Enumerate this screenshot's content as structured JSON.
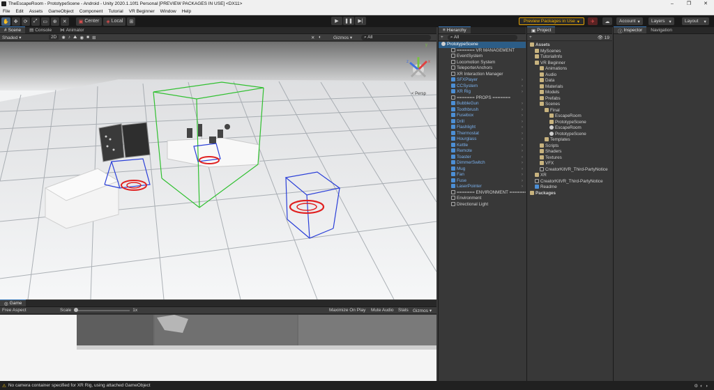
{
  "window": {
    "title": "TheEscapeRoom - PrototypeScene - Android - Unity 2020.1.10f1 Personal [PREVIEW PACKAGES IN USE] <DX11>",
    "controls": [
      "–",
      "❐",
      "✕"
    ]
  },
  "menu": [
    "File",
    "Edit",
    "Assets",
    "GameObject",
    "Component",
    "Tutorial",
    "VR Beginner",
    "Window",
    "Help"
  ],
  "toolbar": {
    "center_label": "Center",
    "local_label": "Local",
    "preview_label": "Preview Packages in Use",
    "account_label": "Account",
    "layers_label": "Layers",
    "layout_label": "Layout"
  },
  "scene": {
    "tabs": [
      "Scene",
      "Console",
      "Animator"
    ],
    "shading": "Shaded",
    "mode_2d": "2D",
    "gizmos_label": "Gizmos",
    "search_prefix": "All",
    "persp_label": "< Persp",
    "axis": {
      "x": "x",
      "y": "y",
      "z": "z"
    }
  },
  "game": {
    "tab": "Game",
    "aspect": "Free Aspect",
    "scale_label": "Scale",
    "scale_value": "1x",
    "maximize": "Maximize On Play",
    "mute": "Mute Audio",
    "stats": "Stats",
    "gizmos": "Gizmos"
  },
  "hierarchy": {
    "tab": "Hierarchy",
    "search_prefix": "All",
    "add_label": "+",
    "rows": [
      {
        "label": "PrototypeScene",
        "indent": 0,
        "kind": "unity",
        "sel": true
      },
      {
        "label": "======= VR MANAGEMENT",
        "indent": 2,
        "kind": "cube"
      },
      {
        "label": "EventSystem",
        "indent": 2,
        "kind": "cube"
      },
      {
        "label": "Locomotion System",
        "indent": 2,
        "kind": "cube"
      },
      {
        "label": "TeleporterAnchors",
        "indent": 2,
        "kind": "cube"
      },
      {
        "label": "XR Interaction Manager",
        "indent": 2,
        "kind": "cube"
      },
      {
        "label": "SFXPlayer",
        "indent": 2,
        "kind": "blue",
        "prefab": true
      },
      {
        "label": "CCSystem",
        "indent": 2,
        "kind": "blue",
        "prefab": true
      },
      {
        "label": "XR Rig",
        "indent": 2,
        "kind": "blue",
        "prefab": true
      },
      {
        "label": "======= PROPS =======",
        "indent": 2,
        "kind": "cube"
      },
      {
        "label": "BubbleGun",
        "indent": 2,
        "kind": "blue",
        "prefab": true
      },
      {
        "label": "Toothbrush",
        "indent": 2,
        "kind": "blue",
        "prefab": true
      },
      {
        "label": "Fusebox",
        "indent": 2,
        "kind": "blue",
        "prefab": true
      },
      {
        "label": "Drill",
        "indent": 2,
        "kind": "blue",
        "prefab": true
      },
      {
        "label": "Flashlight",
        "indent": 2,
        "kind": "blue",
        "prefab": true
      },
      {
        "label": "Thermostat",
        "indent": 2,
        "kind": "blue",
        "prefab": true
      },
      {
        "label": "Hourglass",
        "indent": 2,
        "kind": "blue",
        "prefab": true
      },
      {
        "label": "Kettle",
        "indent": 2,
        "kind": "blue",
        "prefab": true
      },
      {
        "label": "Remote",
        "indent": 2,
        "kind": "blue",
        "prefab": true
      },
      {
        "label": "Toaster",
        "indent": 2,
        "kind": "blue",
        "prefab": true
      },
      {
        "label": "DimmerSwitch",
        "indent": 2,
        "kind": "blue",
        "prefab": true
      },
      {
        "label": "Mug",
        "indent": 2,
        "kind": "blue",
        "prefab": true
      },
      {
        "label": "Fan",
        "indent": 2,
        "kind": "blue",
        "prefab": true
      },
      {
        "label": "Fuse",
        "indent": 2,
        "kind": "blue",
        "prefab": true
      },
      {
        "label": "LaserPointer",
        "indent": 2,
        "kind": "blue",
        "prefab": true
      },
      {
        "label": "======= ENVIRONMENT =======",
        "indent": 2,
        "kind": "cube"
      },
      {
        "label": "Environment",
        "indent": 2,
        "kind": "cube"
      },
      {
        "label": "Directional Light",
        "indent": 2,
        "kind": "cube"
      }
    ]
  },
  "project": {
    "tab": "Project",
    "add_label": "+",
    "badge": "19",
    "rows": [
      {
        "label": "Assets",
        "indent": 0,
        "kind": "folder",
        "bold": true
      },
      {
        "label": "MyScenes",
        "indent": 1,
        "kind": "folder"
      },
      {
        "label": "TutorialInfo",
        "indent": 1,
        "kind": "folder"
      },
      {
        "label": "VR Beginner",
        "indent": 1,
        "kind": "folder"
      },
      {
        "label": "Animations",
        "indent": 2,
        "kind": "folder"
      },
      {
        "label": "Audio",
        "indent": 2,
        "kind": "folder"
      },
      {
        "label": "Data",
        "indent": 2,
        "kind": "folder"
      },
      {
        "label": "Materials",
        "indent": 2,
        "kind": "folder"
      },
      {
        "label": "Models",
        "indent": 2,
        "kind": "folder"
      },
      {
        "label": "Prefabs",
        "indent": 2,
        "kind": "folder"
      },
      {
        "label": "Scenes",
        "indent": 2,
        "kind": "folder"
      },
      {
        "label": "Final",
        "indent": 3,
        "kind": "folder"
      },
      {
        "label": "EscapeRoom",
        "indent": 4,
        "kind": "folder"
      },
      {
        "label": "PrototypeScene",
        "indent": 4,
        "kind": "folder"
      },
      {
        "label": "EscapeRoom",
        "indent": 4,
        "kind": "unity"
      },
      {
        "label": "PrototypeScene",
        "indent": 4,
        "kind": "unity"
      },
      {
        "label": "Templates",
        "indent": 3,
        "kind": "folder"
      },
      {
        "label": "Scripts",
        "indent": 2,
        "kind": "folder"
      },
      {
        "label": "Shaders",
        "indent": 2,
        "kind": "folder"
      },
      {
        "label": "Textures",
        "indent": 2,
        "kind": "folder"
      },
      {
        "label": "VFX",
        "indent": 2,
        "kind": "folder"
      },
      {
        "label": "CreatorKitVR_Third-PartyNotice",
        "indent": 2,
        "kind": "cube"
      },
      {
        "label": "XR",
        "indent": 1,
        "kind": "folder"
      },
      {
        "label": "CreatorKitVR_Third-PartyNotice",
        "indent": 1,
        "kind": "cube"
      },
      {
        "label": "Readme",
        "indent": 1,
        "kind": "blue"
      },
      {
        "label": "Packages",
        "indent": 0,
        "kind": "folder",
        "bold": true
      }
    ]
  },
  "inspector": {
    "tabs": [
      "Inspector",
      "Navigation"
    ]
  },
  "status": {
    "message": "No camera container specified for XR Rig, using attached GameObject"
  }
}
